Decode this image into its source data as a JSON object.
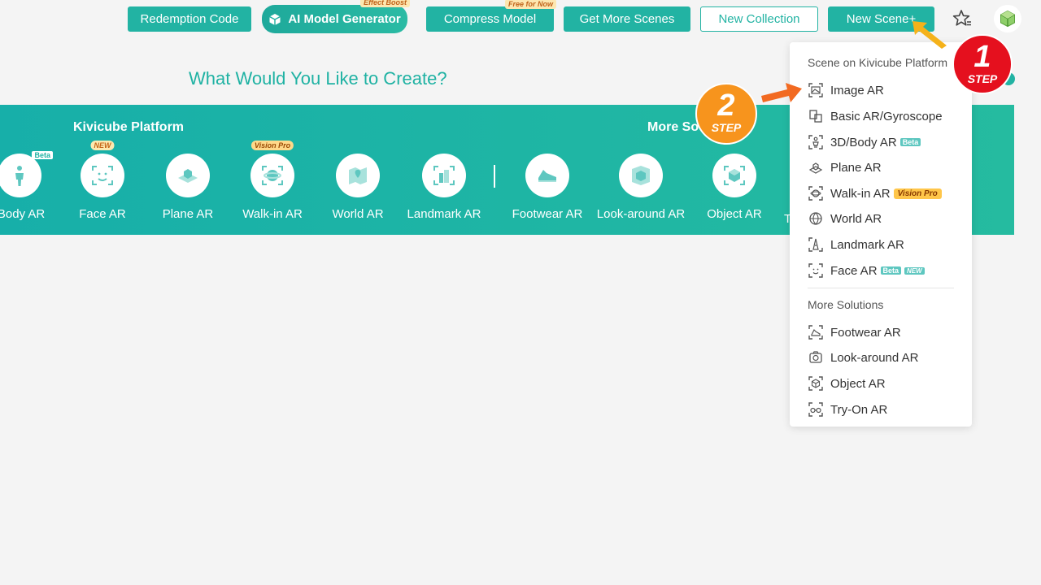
{
  "toolbar": {
    "redemption_code": "Redemption Code",
    "ai_model_generator": "AI Model Generator",
    "ai_model_tag": "Effect Boost",
    "compress_model": "Compress Model",
    "compress_tag": "Free for Now",
    "get_more_scenes": "Get More Scenes",
    "new_collection": "New Collection",
    "new_scene": "New Scene+"
  },
  "heading": "What Would You Like to Create?",
  "banner": {
    "platform_title": "Kivicube Platform",
    "more_title": "More So",
    "items": [
      {
        "label": "/Body AR",
        "badge": "Beta"
      },
      {
        "label": "Face AR",
        "badge": "NEW"
      },
      {
        "label": "Plane AR",
        "badge": ""
      },
      {
        "label": "Walk-in AR",
        "badge": "Vision Pro"
      },
      {
        "label": "World AR",
        "badge": ""
      },
      {
        "label": "Landmark AR",
        "badge": ""
      },
      {
        "label": "Footwear AR",
        "badge": ""
      },
      {
        "label": "Look-around AR",
        "badge": ""
      },
      {
        "label": "Object AR",
        "badge": ""
      },
      {
        "label": "T",
        "badge": ""
      }
    ]
  },
  "dropdown": {
    "section_platform": "Scene on Kivicube Platform",
    "section_more": "More Solutions",
    "platform_items": [
      {
        "label": "Image AR",
        "icon": "image-ar-icon"
      },
      {
        "label": "Basic AR/Gyroscope",
        "icon": "gyroscope-icon"
      },
      {
        "label": "3D/Body AR",
        "icon": "body-ar-icon",
        "badge": "Beta"
      },
      {
        "label": "Plane AR",
        "icon": "plane-ar-icon"
      },
      {
        "label": "Walk-in AR",
        "icon": "walk-in-ar-icon",
        "badge": "Vision Pro"
      },
      {
        "label": "World AR",
        "icon": "world-ar-icon"
      },
      {
        "label": "Landmark AR",
        "icon": "landmark-ar-icon"
      },
      {
        "label": "Face AR",
        "icon": "face-ar-icon",
        "badge": "Beta",
        "badge2": "NEW"
      }
    ],
    "more_items": [
      {
        "label": "Footwear AR",
        "icon": "footwear-ar-icon"
      },
      {
        "label": "Look-around AR",
        "icon": "look-around-ar-icon"
      },
      {
        "label": "Object AR",
        "icon": "object-ar-icon"
      },
      {
        "label": "Try-On AR",
        "icon": "try-on-ar-icon"
      }
    ]
  },
  "steps": {
    "step1_num": "1",
    "step2_num": "2",
    "step_word": "STEP"
  },
  "colors": {
    "accent": "#22b3a3",
    "step1": "#e5101e",
    "step2": "#f7941d",
    "arrow1": "#f5b21a",
    "arrow2": "#f26a21"
  }
}
